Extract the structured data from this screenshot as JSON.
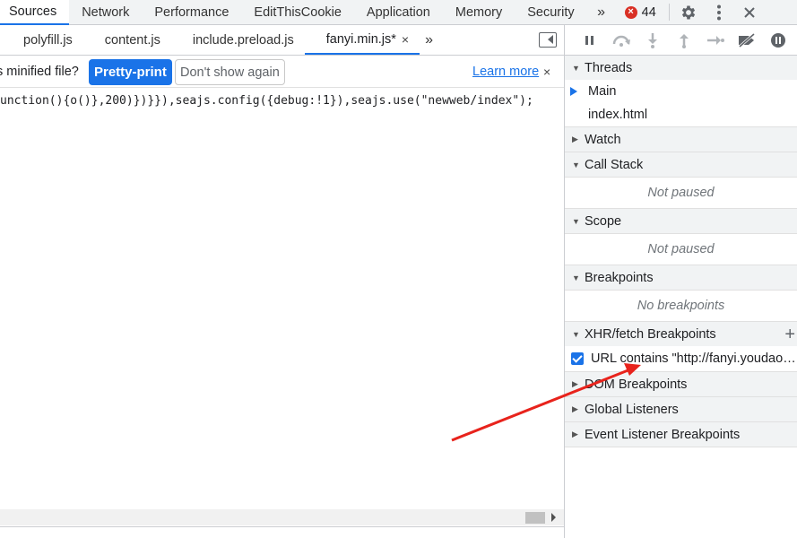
{
  "top_tabs": [
    "Sources",
    "Network",
    "Performance",
    "EditThisCookie",
    "Application",
    "Memory",
    "Security"
  ],
  "more_tabs_label": "»",
  "error_count": "44",
  "error_icon_glyph": "×",
  "file_tabs": {
    "items": [
      "polyfill.js",
      "content.js",
      "include.preload.js"
    ],
    "active": "fanyi.min.js*",
    "close_glyph": "×",
    "more_label": "»"
  },
  "infobar": {
    "message": "s minified file?",
    "pretty_print": "Pretty-print",
    "dont_show": "Don't show again",
    "learn_more": "Learn more",
    "close_glyph": "×"
  },
  "code_line": "unction(){o()},200)})}}),seajs.config({debug:!1}),seajs.use(\"newweb/index\");",
  "debugger": {
    "threads": {
      "title": "Threads",
      "items": [
        "Main",
        "index.html"
      ]
    },
    "watch_title": "Watch",
    "call_stack": {
      "title": "Call Stack",
      "empty": "Not paused"
    },
    "scope": {
      "title": "Scope",
      "empty": "Not paused"
    },
    "breakpoints": {
      "title": "Breakpoints",
      "empty": "No breakpoints"
    },
    "xhr": {
      "title": "XHR/fetch Breakpoints",
      "add_glyph": "+",
      "item": "URL contains \"http://fanyi.youdao.com/translate_o?smartresult=dict&smartresult=rule\""
    },
    "dom_title": "DOM Breakpoints",
    "global_title": "Global Listeners",
    "event_title": "Event Listener Breakpoints"
  },
  "colors": {
    "accent": "#1a73e8",
    "error": "#d93025",
    "annotation": "#e8231c"
  }
}
